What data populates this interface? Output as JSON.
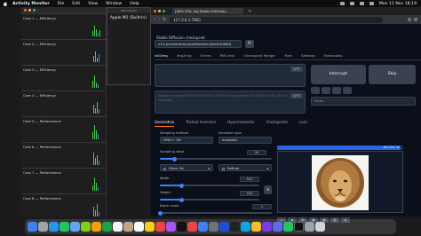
{
  "menubar": {
    "app": "Activity Monitor",
    "items": [
      "File",
      "Edit",
      "View",
      "Window",
      "Help"
    ],
    "clock": "Mon 11 Nov 18:19"
  },
  "activity_monitor": {
    "cores": [
      "Core 1 — Efficiency",
      "Core 2 — Efficiency",
      "Core 3 — Efficiency",
      "Core 4 — Efficiency",
      "Core 5 — Performance",
      "Core 6 — Performance",
      "Core 7 — Performance",
      "Core 8 — Performance"
    ],
    "gpu_window_title": "GPU History",
    "gpu_name": "Apple M1 (Built-In)"
  },
  "browser": {
    "tab_title": "[98% ETA: 4s] Stable Diffusion",
    "url": "127.0.0.1:7860"
  },
  "webui": {
    "checkpoint_label": "Stable Diffusion checkpoint",
    "checkpoint_value": "v1-5-pruned-emaonly.safetensors [6ce0161689]",
    "refresh_icon": "refresh-icon",
    "top_tabs": [
      "txt2img",
      "img2img",
      "Extras",
      "PNG Info",
      "Checkpoint Merger",
      "Train",
      "Settings",
      "Extensions"
    ],
    "prompt_counter": "0/75",
    "negative_placeholder": "Negative prompt (Press Ctrl+Enter or Alt+Enter to generate, Alt+Enter to skip, Esc to interrupt)",
    "negative_counter": "0/75",
    "interrupt_label": "Interrupt",
    "skip_label": "Skip",
    "styles_placeholder": "Styles",
    "gen_tabs": [
      "Generation",
      "Textual Inversion",
      "Hypernetworks",
      "Checkpoints",
      "Lora"
    ],
    "sampling_method_label": "Sampling method",
    "sampling_method_value": "DPM++ 2M",
    "schedule_type_label": "Schedule type",
    "schedule_type_value": "Automatic",
    "sampling_steps_label": "Sampling steps",
    "sampling_steps_value": "20",
    "sampling_steps_fraction": 0.13,
    "hires_fix_label": "Hires. fix",
    "refiner_label": "Refiner",
    "width_label": "Width",
    "width_value": "512",
    "width_fraction": 0.22,
    "height_label": "Height",
    "height_value": "512",
    "height_fraction": 0.22,
    "batch_count_label": "Batch count",
    "batch_count_value": "1",
    "batch_count_fraction": 0.0,
    "swap_icon": "swap-icon",
    "progress_text": "98% ETA: 4s",
    "progress_fraction": 0.98,
    "gallery_tools": [
      "folder-icon",
      "save-icon",
      "zip-icon",
      "img2img-icon",
      "inpaint-icon",
      "extras-icon",
      "palette-icon"
    ]
  },
  "colors": {
    "accent": "#ff7c00",
    "progress": "#2563eb",
    "cpu_green": "#3fd13f",
    "cpu_blue": "#4c7dff"
  },
  "dock": {
    "apps": [
      "Finder",
      "Launchpad",
      "Safari",
      "Messages",
      "Mail",
      "Maps",
      "Photos",
      "FaceTime",
      "Calendar",
      "Contacts",
      "Reminders",
      "Notes",
      "Music",
      "Podcasts",
      "TV",
      "News",
      "App Store",
      "Settings",
      "Xcode",
      "Terminal",
      "VS Code",
      "Chrome",
      "Slack",
      "Discord",
      "Spotify",
      "Activity Monitor",
      "Preview",
      "Trash"
    ]
  }
}
